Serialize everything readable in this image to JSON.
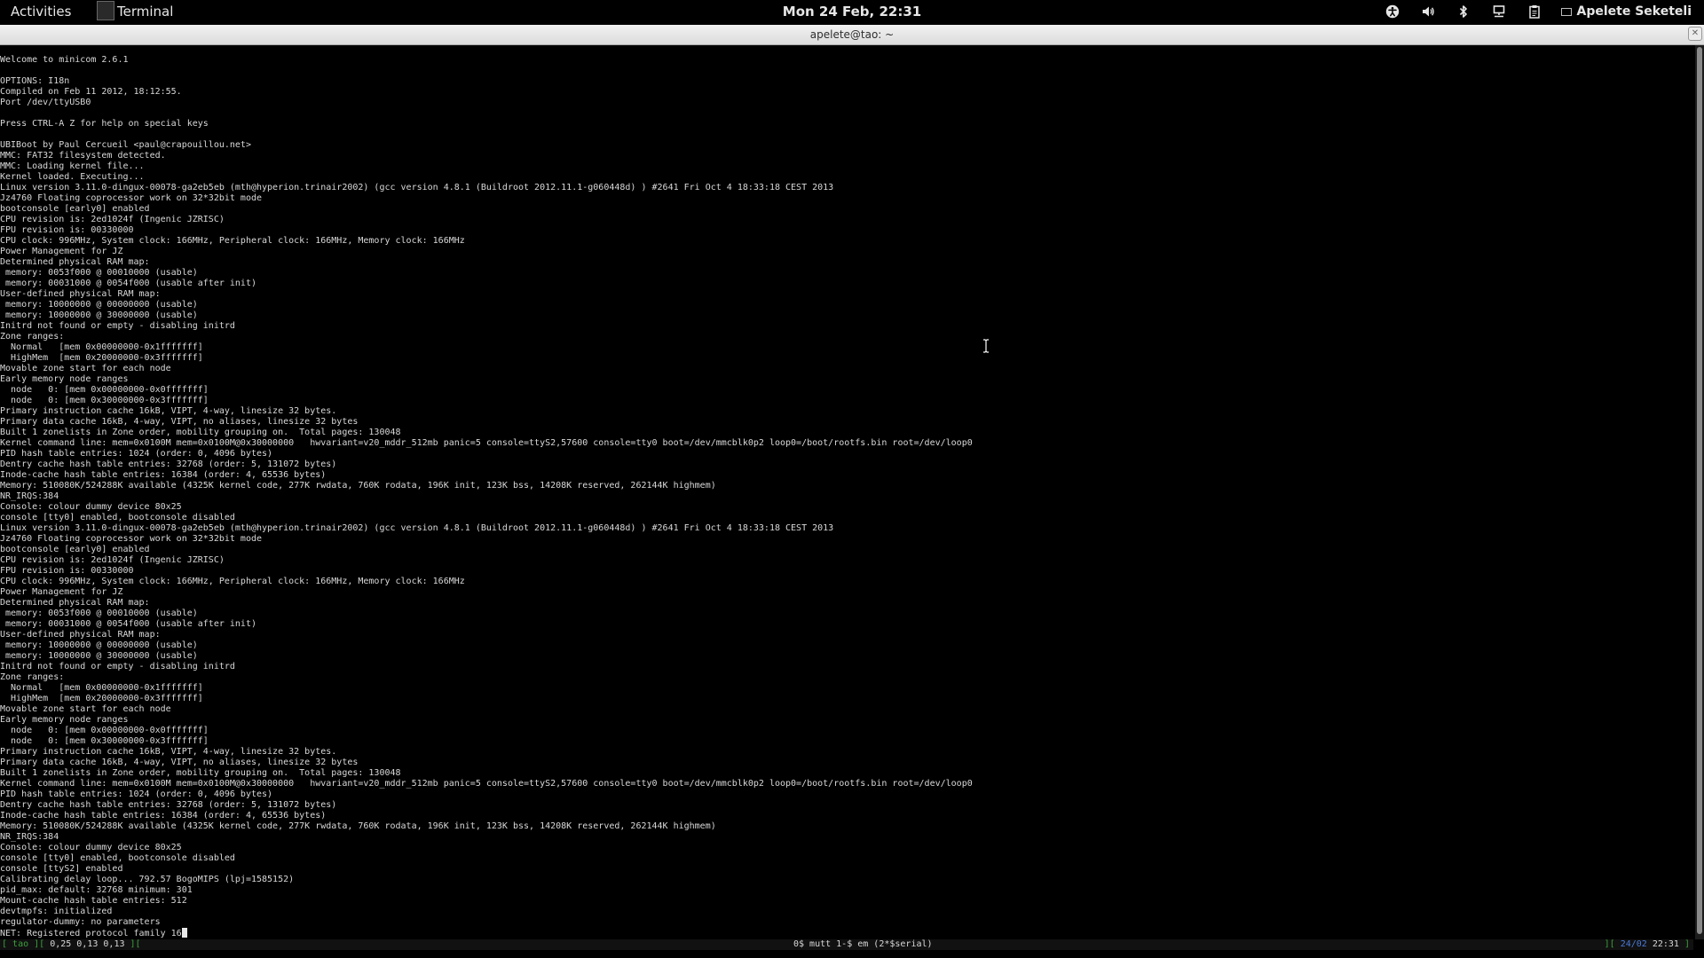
{
  "topbar": {
    "activities": "Activities",
    "app_name": "Terminal",
    "clock": "Mon 24 Feb, 22:31",
    "user": "Apelete Seketeli",
    "tray_icons": [
      "accessibility-icon",
      "volume-icon",
      "bluetooth-icon",
      "network-icon",
      "clipboard-icon"
    ]
  },
  "window": {
    "title": "apelete@tao: ~"
  },
  "terminal": {
    "lines": [
      "Welcome to minicom 2.6.1",
      "",
      "OPTIONS: I18n",
      "Compiled on Feb 11 2012, 18:12:55.",
      "Port /dev/ttyUSB0",
      "",
      "Press CTRL-A Z for help on special keys",
      "",
      "UBIBoot by Paul Cercueil <paul@crapouillou.net>",
      "MMC: FAT32 filesystem detected.",
      "MMC: Loading kernel file...",
      "Kernel loaded. Executing...",
      "Linux version 3.11.0-dingux-00078-ga2eb5eb (mth@hyperion.trinair2002) (gcc version 4.8.1 (Buildroot 2012.11.1-g060448d) ) #2641 Fri Oct 4 18:33:18 CEST 2013",
      "Jz4760 Floating coprocessor work on 32*32bit mode",
      "bootconsole [early0] enabled",
      "CPU revision is: 2ed1024f (Ingenic JZRISC)",
      "FPU revision is: 00330000",
      "CPU clock: 996MHz, System clock: 166MHz, Peripheral clock: 166MHz, Memory clock: 166MHz",
      "Power Management for JZ",
      "Determined physical RAM map:",
      " memory: 0053f000 @ 00010000 (usable)",
      " memory: 00031000 @ 0054f000 (usable after init)",
      "User-defined physical RAM map:",
      " memory: 10000000 @ 00000000 (usable)",
      " memory: 10000000 @ 30000000 (usable)",
      "Initrd not found or empty - disabling initrd",
      "Zone ranges:",
      "  Normal   [mem 0x00000000-0x1fffffff]",
      "  HighMem  [mem 0x20000000-0x3fffffff]",
      "Movable zone start for each node",
      "Early memory node ranges",
      "  node   0: [mem 0x00000000-0x0fffffff]",
      "  node   0: [mem 0x30000000-0x3fffffff]",
      "Primary instruction cache 16kB, VIPT, 4-way, linesize 32 bytes.",
      "Primary data cache 16kB, 4-way, VIPT, no aliases, linesize 32 bytes",
      "Built 1 zonelists in Zone order, mobility grouping on.  Total pages: 130048",
      "Kernel command line: mem=0x0100M mem=0x0100M@0x30000000   hwvariant=v20_mddr_512mb panic=5 console=ttyS2,57600 console=tty0 boot=/dev/mmcblk0p2 loop0=/boot/rootfs.bin root=/dev/loop0",
      "PID hash table entries: 1024 (order: 0, 4096 bytes)",
      "Dentry cache hash table entries: 32768 (order: 5, 131072 bytes)",
      "Inode-cache hash table entries: 16384 (order: 4, 65536 bytes)",
      "Memory: 510080K/524288K available (4325K kernel code, 277K rwdata, 760K rodata, 196K init, 123K bss, 14208K reserved, 262144K highmem)",
      "NR_IRQS:384",
      "Console: colour dummy device 80x25",
      "console [tty0] enabled, bootconsole disabled",
      "Linux version 3.11.0-dingux-00078-ga2eb5eb (mth@hyperion.trinair2002) (gcc version 4.8.1 (Buildroot 2012.11.1-g060448d) ) #2641 Fri Oct 4 18:33:18 CEST 2013",
      "Jz4760 Floating coprocessor work on 32*32bit mode",
      "bootconsole [early0] enabled",
      "CPU revision is: 2ed1024f (Ingenic JZRISC)",
      "FPU revision is: 00330000",
      "CPU clock: 996MHz, System clock: 166MHz, Peripheral clock: 166MHz, Memory clock: 166MHz",
      "Power Management for JZ",
      "Determined physical RAM map:",
      " memory: 0053f000 @ 00010000 (usable)",
      " memory: 00031000 @ 0054f000 (usable after init)",
      "User-defined physical RAM map:",
      " memory: 10000000 @ 00000000 (usable)",
      " memory: 10000000 @ 30000000 (usable)",
      "Initrd not found or empty - disabling initrd",
      "Zone ranges:",
      "  Normal   [mem 0x00000000-0x1fffffff]",
      "  HighMem  [mem 0x20000000-0x3fffffff]",
      "Movable zone start for each node",
      "Early memory node ranges",
      "  node   0: [mem 0x00000000-0x0fffffff]",
      "  node   0: [mem 0x30000000-0x3fffffff]",
      "Primary instruction cache 16kB, VIPT, 4-way, linesize 32 bytes.",
      "Primary data cache 16kB, 4-way, VIPT, no aliases, linesize 32 bytes",
      "Built 1 zonelists in Zone order, mobility grouping on.  Total pages: 130048",
      "Kernel command line: mem=0x0100M mem=0x0100M@0x30000000   hwvariant=v20_mddr_512mb panic=5 console=ttyS2,57600 console=tty0 boot=/dev/mmcblk0p2 loop0=/boot/rootfs.bin root=/dev/loop0",
      "PID hash table entries: 1024 (order: 0, 4096 bytes)",
      "Dentry cache hash table entries: 32768 (order: 5, 131072 bytes)",
      "Inode-cache hash table entries: 16384 (order: 4, 65536 bytes)",
      "Memory: 510080K/524288K available (4325K kernel code, 277K rwdata, 760K rodata, 196K init, 123K bss, 14208K reserved, 262144K highmem)",
      "NR_IRQS:384",
      "Console: colour dummy device 80x25",
      "console [tty0] enabled, bootconsole disabled",
      "console [ttyS2] enabled",
      "Calibrating delay loop... 792.57 BogoMIPS (lpj=1585152)",
      "pid_max: default: 32768 minimum: 301",
      "Mount-cache hash table entries: 512",
      "devtmpfs: initialized",
      "regulator-dummy: no parameters",
      "NET: Registered protocol family 16"
    ]
  },
  "status_bar": {
    "left_open": "[ ",
    "host": "tao",
    "left_mid": " ][ ",
    "load": "0,25 0,13 0,13",
    "left_close": " ][",
    "windows": "0$ mutt  1-$ em  (2*$serial)",
    "right_open": "][ ",
    "date": "24/02",
    "time": " 22:31",
    "right_close": " ]"
  }
}
